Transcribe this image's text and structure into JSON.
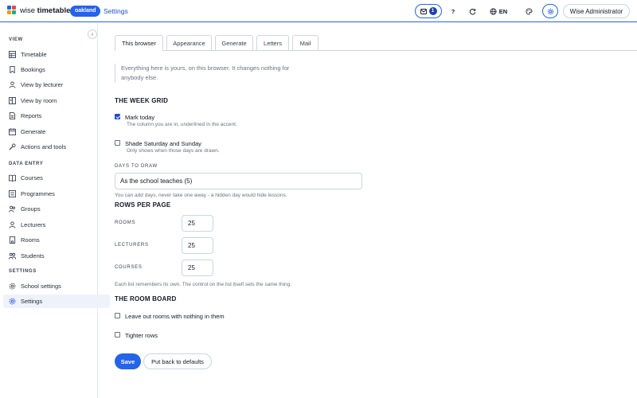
{
  "header": {
    "brand_plain": "wise ",
    "brand_bold": "timetable",
    "school": "oakland",
    "breadcrumb": "Settings",
    "inbox_count": "1",
    "help": "?",
    "language": "EN",
    "user": "Wise Administrator"
  },
  "colors": {
    "accent": "#2563eb",
    "logo": [
      "#2563eb",
      "#ef4444",
      "#f59e0b",
      "#10b981"
    ]
  },
  "sidebar": {
    "sections": [
      {
        "label": "VIEW",
        "items": [
          {
            "label": "Timetable",
            "icon": "grid-icon"
          },
          {
            "label": "Bookings",
            "icon": "bookmark-icon"
          },
          {
            "label": "View by lecturer",
            "icon": "person-icon"
          },
          {
            "label": "View by room",
            "icon": "room-icon"
          },
          {
            "label": "Reports",
            "icon": "document-icon"
          },
          {
            "label": "Generate",
            "icon": "calendar-icon"
          },
          {
            "label": "Actions and tools",
            "icon": "wrench-icon"
          }
        ]
      },
      {
        "label": "DATA ENTRY",
        "items": [
          {
            "label": "Courses",
            "icon": "book-icon"
          },
          {
            "label": "Programmes",
            "icon": "list-icon"
          },
          {
            "label": "Groups",
            "icon": "group-icon"
          },
          {
            "label": "Lecturers",
            "icon": "person-icon"
          },
          {
            "label": "Rooms",
            "icon": "building-icon"
          },
          {
            "label": "Students",
            "icon": "students-icon"
          }
        ]
      },
      {
        "label": "SETTINGS",
        "items": [
          {
            "label": "School settings",
            "icon": "gear-icon"
          },
          {
            "label": "Settings",
            "icon": "gear-icon",
            "active": true
          }
        ]
      }
    ]
  },
  "tabs": [
    "This browser",
    "Appearance",
    "Generate",
    "Letters",
    "Mail"
  ],
  "active_tab": "This browser",
  "intro": "Everything here is yours, on this browser. It changes nothing for anybody else.",
  "week_grid": {
    "heading": "THE WEEK GRID",
    "mark_today": {
      "label": "Mark today",
      "hint": "The column you are in, underlined in the accent.",
      "checked": true
    },
    "shade_weekend": {
      "label": "Shade Saturday and Sunday",
      "hint": "Only shows when those days are drawn.",
      "checked": false
    },
    "days_label": "DAYS TO DRAW",
    "days_value": "As the school teaches (5)",
    "days_hint": "You can add days, never take one away - a hidden day would hide lessons."
  },
  "rows_per_page": {
    "heading": "ROWS PER PAGE",
    "rooms_label": "ROOMS",
    "rooms_value": "25",
    "lecturers_label": "LECTURERS",
    "lecturers_value": "25",
    "courses_label": "COURSES",
    "courses_value": "25",
    "hint": "Each list remembers its own. The control on the list itself sets the same thing."
  },
  "room_board": {
    "heading": "THE ROOM BOARD",
    "leave_out": {
      "label": "Leave out rooms with nothing in them",
      "checked": false
    },
    "tighter": {
      "label": "Tighter rows",
      "checked": false
    }
  },
  "actions": {
    "save": "Save",
    "reset": "Put back to defaults"
  }
}
